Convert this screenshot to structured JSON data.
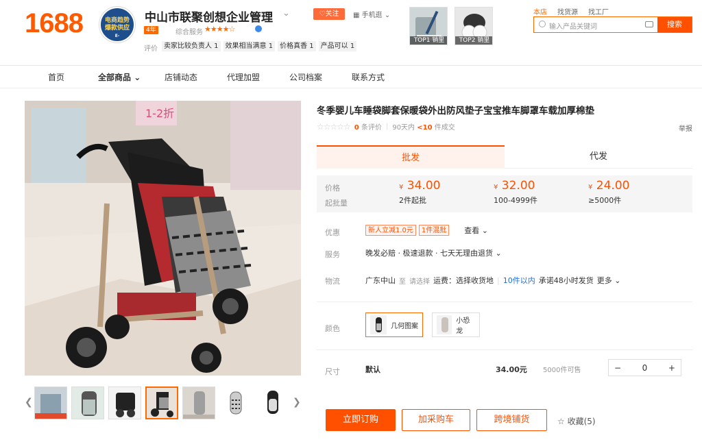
{
  "header": {
    "logo": "1688",
    "shop_logo_text": "电商趋势爆款供应",
    "shop_logo_sub": "E-WINHELPERS",
    "shop_name": "中山市联聚创想企业管理",
    "follow_label": "关注",
    "mobile_label": "手机逛",
    "years_badge": "4年",
    "service_label": "综合服务",
    "stars": "★★★★☆",
    "review_label": "评价",
    "review_tags": [
      "卖家比较负责人 1",
      "效果相当满意 1",
      "价格真香 1",
      "产品可以 1"
    ],
    "top_items": [
      {
        "label": "TOP1 销里"
      },
      {
        "label": "TOP2 销里"
      }
    ],
    "top_links": [
      "本店",
      "找货源",
      "找工厂"
    ],
    "search_placeholder": "输入产品关键词",
    "search_button": "搜索"
  },
  "nav": [
    "首页",
    "全部商品",
    "店铺动态",
    "代理加盟",
    "公司档案",
    "联系方式"
  ],
  "gallery": {
    "banner_text": "1-2折"
  },
  "product": {
    "title": "冬季婴儿车睡袋脚套保暖袋外出防风垫子宝宝推车脚罩车载加厚棉垫",
    "stars": "☆☆☆☆☆",
    "review_count": "0",
    "review_suffix": "条评价",
    "sales_prefix": "90天内",
    "sales_value": "<10",
    "sales_suffix": "件成交",
    "report": "举报"
  },
  "tabs": {
    "wholesale": "批发",
    "dropship": "代发"
  },
  "prices": {
    "price_label": "价格",
    "qty_label": "起批量",
    "tiers": [
      {
        "price": "34.00",
        "qty": "2件起批"
      },
      {
        "price": "32.00",
        "qty": "100-4999件"
      },
      {
        "price": "24.00",
        "qty": "≥5000件"
      }
    ],
    "currency": "¥"
  },
  "promo": {
    "label": "优惠",
    "coupons": [
      "新人立减1.0元",
      "1件混批"
    ],
    "more": "查看 ⌄"
  },
  "service": {
    "label": "服务",
    "text": "晚发必赔 · 极速退款 · 七天无理由退货 ⌄"
  },
  "logistics": {
    "label": "物流",
    "from": "广东中山",
    "to": "至",
    "choose": "请选择",
    "fee": "运费：选择收货地",
    "days": "10件以内",
    "promise": "承诺48小时发货",
    "more": "更多 ⌄"
  },
  "color": {
    "label": "颜色",
    "options": [
      "几何图案",
      "小恐龙"
    ]
  },
  "size": {
    "label": "尺寸",
    "value": "默认",
    "price": "34.00元",
    "stock": "5000件可售",
    "qty": "0",
    "minus": "−",
    "plus": "+"
  },
  "actions": {
    "buy": "立即订购",
    "cart": "加采购车",
    "cross": "跨境铺货",
    "favorite": "收藏(5)"
  },
  "colors": {
    "accent": "#ff5000"
  }
}
